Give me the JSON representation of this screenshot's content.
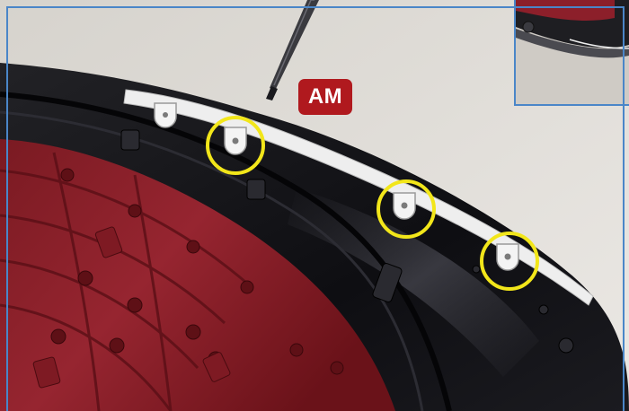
{
  "badge": {
    "label": "AM",
    "color": "#b0191e"
  },
  "colors": {
    "frame": "#4a86c8",
    "highlight_circle": "#f2e61a",
    "panel_red": "#8c1f2a",
    "trim_black": "#15151a",
    "background": "#d8d5d0"
  },
  "highlighted_clips": 3
}
